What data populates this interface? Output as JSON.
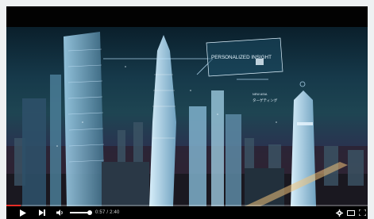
{
  "video": {
    "overlay_title": "PERSONALIZED INSIGHT",
    "overlay_tag": "NEW ASIA",
    "overlay_sub": "ターゲティング",
    "progress_fraction": 0.04,
    "volume_fraction": 0.95
  },
  "controls": {
    "time_display": "0:57 / 2:40",
    "icons": [
      "play-icon",
      "next-icon",
      "volume-icon",
      "settings-icon",
      "miniplayer-icon",
      "fullscreen-icon"
    ]
  },
  "colors": {
    "progress": "#e52d27",
    "hud": "#cfe9ff"
  }
}
